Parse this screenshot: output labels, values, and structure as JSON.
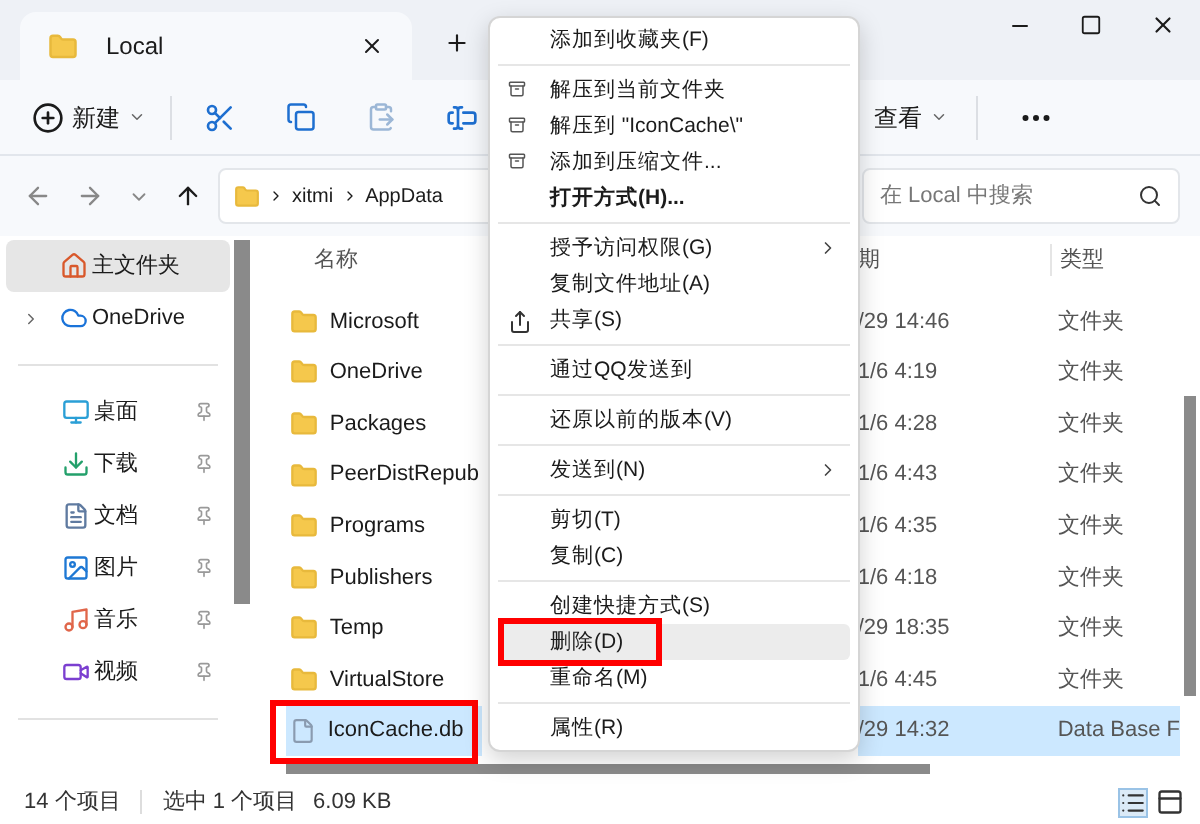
{
  "window": {
    "tab_title": "Local"
  },
  "toolbar": {
    "new_label": "新建",
    "view_label": "查看"
  },
  "address": {
    "path": [
      "xitmi",
      "AppData"
    ],
    "search_placeholder": "在 Local 中搜索"
  },
  "sidebar": {
    "top": [
      {
        "label": "主文件夹",
        "selected": true,
        "expandable": false
      },
      {
        "label": "OneDrive",
        "selected": false,
        "expandable": true
      }
    ],
    "quick": [
      {
        "label": "桌面",
        "selected": false,
        "pinned": true
      },
      {
        "label": "下载",
        "selected": false,
        "pinned": true
      },
      {
        "label": "文档",
        "selected": false,
        "pinned": true
      },
      {
        "label": "图片",
        "selected": false,
        "pinned": true
      },
      {
        "label": "音乐",
        "selected": false,
        "pinned": true
      },
      {
        "label": "视频",
        "selected": false,
        "pinned": true
      }
    ]
  },
  "table": {
    "columns": [
      "名称",
      "期",
      "类型"
    ],
    "rows": [
      {
        "name": "Microsoft",
        "kind": "folder",
        "date": "/29 14:46",
        "type": "文件夹",
        "selected": false,
        "marked": false
      },
      {
        "name": "OneDrive",
        "kind": "folder",
        "date": "1/6 4:19",
        "type": "文件夹",
        "selected": false,
        "marked": false
      },
      {
        "name": "Packages",
        "kind": "folder",
        "date": "1/6 4:28",
        "type": "文件夹",
        "selected": false,
        "marked": false
      },
      {
        "name": "PeerDistRepub",
        "kind": "folder",
        "date": "1/6 4:43",
        "type": "文件夹",
        "selected": false,
        "marked": false
      },
      {
        "name": "Programs",
        "kind": "folder",
        "date": "1/6 4:35",
        "type": "文件夹",
        "selected": false,
        "marked": false
      },
      {
        "name": "Publishers",
        "kind": "folder",
        "date": "1/6 4:18",
        "type": "文件夹",
        "selected": false,
        "marked": false
      },
      {
        "name": "Temp",
        "kind": "folder",
        "date": "/29 18:35",
        "type": "文件夹",
        "selected": false,
        "marked": false
      },
      {
        "name": "VirtualStore",
        "kind": "folder",
        "date": "1/6 4:45",
        "type": "文件夹",
        "selected": false,
        "marked": false
      },
      {
        "name": "IconCache.db",
        "kind": "file",
        "date": "/29 14:32",
        "type": "Data Base F",
        "selected": true,
        "marked": true
      }
    ]
  },
  "context_menu": {
    "groups": [
      [
        {
          "label": "添加到收藏夹(F)",
          "kind": "plain",
          "bold": false,
          "submenu": false,
          "selected": false,
          "marked": false
        }
      ],
      [
        {
          "label": "解压到当前文件夹",
          "kind": "archive",
          "bold": false,
          "submenu": false,
          "selected": false,
          "marked": false
        },
        {
          "label": "解压到 \"IconCache\\\"",
          "kind": "archive",
          "bold": false,
          "submenu": false,
          "selected": false,
          "marked": false
        },
        {
          "label": "添加到压缩文件...",
          "kind": "archive",
          "bold": false,
          "submenu": false,
          "selected": false,
          "marked": false
        },
        {
          "label": "打开方式(H)...",
          "kind": "plain",
          "bold": true,
          "submenu": false,
          "selected": false,
          "marked": false
        }
      ],
      [
        {
          "label": "授予访问权限(G)",
          "kind": "plain",
          "bold": false,
          "submenu": true,
          "selected": false,
          "marked": false
        },
        {
          "label": "复制文件地址(A)",
          "kind": "plain",
          "bold": false,
          "submenu": false,
          "selected": false,
          "marked": false
        },
        {
          "label": "共享(S)",
          "kind": "share",
          "bold": false,
          "submenu": false,
          "selected": false,
          "marked": false
        }
      ],
      [
        {
          "label": "通过QQ发送到",
          "kind": "plain",
          "bold": false,
          "submenu": false,
          "selected": false,
          "marked": false
        }
      ],
      [
        {
          "label": "还原以前的版本(V)",
          "kind": "plain",
          "bold": false,
          "submenu": false,
          "selected": false,
          "marked": false
        }
      ],
      [
        {
          "label": "发送到(N)",
          "kind": "plain",
          "bold": false,
          "submenu": true,
          "selected": false,
          "marked": false
        }
      ],
      [
        {
          "label": "剪切(T)",
          "kind": "plain",
          "bold": false,
          "submenu": false,
          "selected": false,
          "marked": false
        },
        {
          "label": "复制(C)",
          "kind": "plain",
          "bold": false,
          "submenu": false,
          "selected": false,
          "marked": false
        }
      ],
      [
        {
          "label": "创建快捷方式(S)",
          "kind": "plain",
          "bold": false,
          "submenu": false,
          "selected": false,
          "marked": false
        },
        {
          "label": "删除(D)",
          "kind": "plain",
          "bold": false,
          "submenu": false,
          "selected": true,
          "marked": true
        },
        {
          "label": "重命名(M)",
          "kind": "plain",
          "bold": false,
          "submenu": false,
          "selected": false,
          "marked": false
        }
      ],
      [
        {
          "label": "属性(R)",
          "kind": "plain",
          "bold": false,
          "submenu": false,
          "selected": false,
          "marked": false
        }
      ]
    ]
  },
  "status_bar": {
    "count": "14 个项目",
    "selection": "选中 1 个项目",
    "size": "6.09 KB"
  }
}
